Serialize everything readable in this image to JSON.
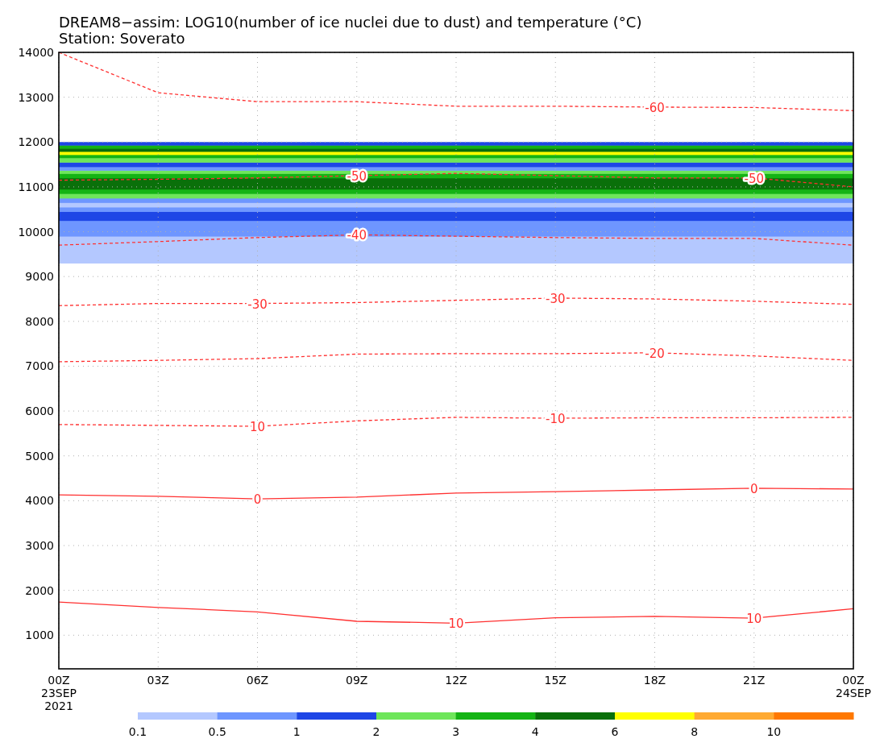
{
  "title": "DREAM8−assim: LOG10(number of ice nuclei due to dust) and temperature (°C)",
  "subtitle": "Station: Soverato",
  "chart_data": {
    "type": "line",
    "categories": [
      "00Z",
      "03Z",
      "06Z",
      "09Z",
      "12Z",
      "15Z",
      "18Z",
      "21Z",
      "00Z"
    ],
    "ylim": [
      250,
      14000
    ],
    "grid": true,
    "yticks": [
      1000,
      2000,
      3000,
      4000,
      5000,
      6000,
      7000,
      8000,
      9000,
      10000,
      11000,
      12000,
      13000,
      14000
    ],
    "series": [
      {
        "color": "#ff3030",
        "line_style": "dashed",
        "values": [
          14000,
          13100,
          12900,
          12900,
          12800,
          12800,
          12780,
          12770,
          12700
        ]
      },
      {
        "color": "#ff3030",
        "line_style": "dashed",
        "values": [
          11150,
          11170,
          11200,
          11250,
          11300,
          11250,
          11200,
          11200,
          11000
        ]
      },
      {
        "color": "#ff3030",
        "line_style": "dashed",
        "values": [
          9700,
          9780,
          9870,
          9930,
          9900,
          9870,
          9850,
          9850,
          9700
        ]
      },
      {
        "color": "#ff3030",
        "line_style": "dashed",
        "values": [
          8350,
          8400,
          8400,
          8420,
          8470,
          8520,
          8500,
          8450,
          8380
        ]
      },
      {
        "color": "#ff3030",
        "line_style": "dashed",
        "values": [
          7100,
          7130,
          7170,
          7270,
          7280,
          7280,
          7300,
          7230,
          7130
        ]
      },
      {
        "color": "#ff3030",
        "line_style": "dashed",
        "values": [
          5700,
          5680,
          5660,
          5780,
          5860,
          5840,
          5850,
          5850,
          5860
        ]
      },
      {
        "color": "#ff3030",
        "line_style": "solid",
        "values": [
          4130,
          4100,
          4040,
          4080,
          4170,
          4200,
          4240,
          4280,
          4260
        ]
      },
      {
        "color": "#ff3030",
        "line_style": "solid",
        "values": [
          1740,
          1620,
          1520,
          1310,
          1270,
          1390,
          1420,
          1380,
          1590
        ]
      }
    ],
    "annotations": [
      {
        "x": "18Z",
        "y": 12780,
        "text": "-60"
      },
      {
        "x": "09Z",
        "y": 11250,
        "text": "-50"
      },
      {
        "x": "21Z",
        "y": 11200,
        "text": "-50"
      },
      {
        "x": "09Z",
        "y": 9930,
        "text": "-40"
      },
      {
        "x": "06Z",
        "y": 8400,
        "text": "-30"
      },
      {
        "x": "15Z",
        "y": 8520,
        "text": "-30"
      },
      {
        "x": "18Z",
        "y": 7300,
        "text": "-20"
      },
      {
        "x": "06Z",
        "y": 5660,
        "text": "10"
      },
      {
        "x": "15Z",
        "y": 5840,
        "text": "-10"
      },
      {
        "x": "06Z",
        "y": 4040,
        "text": "0"
      },
      {
        "x": "21Z",
        "y": 4280,
        "text": "0"
      },
      {
        "x": "12Z",
        "y": 1270,
        "text": "10"
      },
      {
        "x": "21Z",
        "y": 1380,
        "text": "10"
      }
    ]
  },
  "date_labels": [
    {
      "lines": [
        "23SEP",
        "2021"
      ]
    },
    {
      "lines": [
        "24SEP"
      ]
    }
  ],
  "colorbar": [
    {
      "color": "#b4c8ff",
      "label": "0.1"
    },
    {
      "color": "#6e96ff",
      "label": "0.5"
    },
    {
      "color": "#1e46e6",
      "label": "1"
    },
    {
      "color": "#6ee65a",
      "label": "2"
    },
    {
      "color": "#14b414",
      "label": "3"
    },
    {
      "color": "#0a700a",
      "label": "4"
    },
    {
      "color": "#ffff00",
      "label": "6"
    },
    {
      "color": "#ffaa32",
      "label": "8"
    },
    {
      "color": "#ff7800",
      "label": "10"
    }
  ]
}
